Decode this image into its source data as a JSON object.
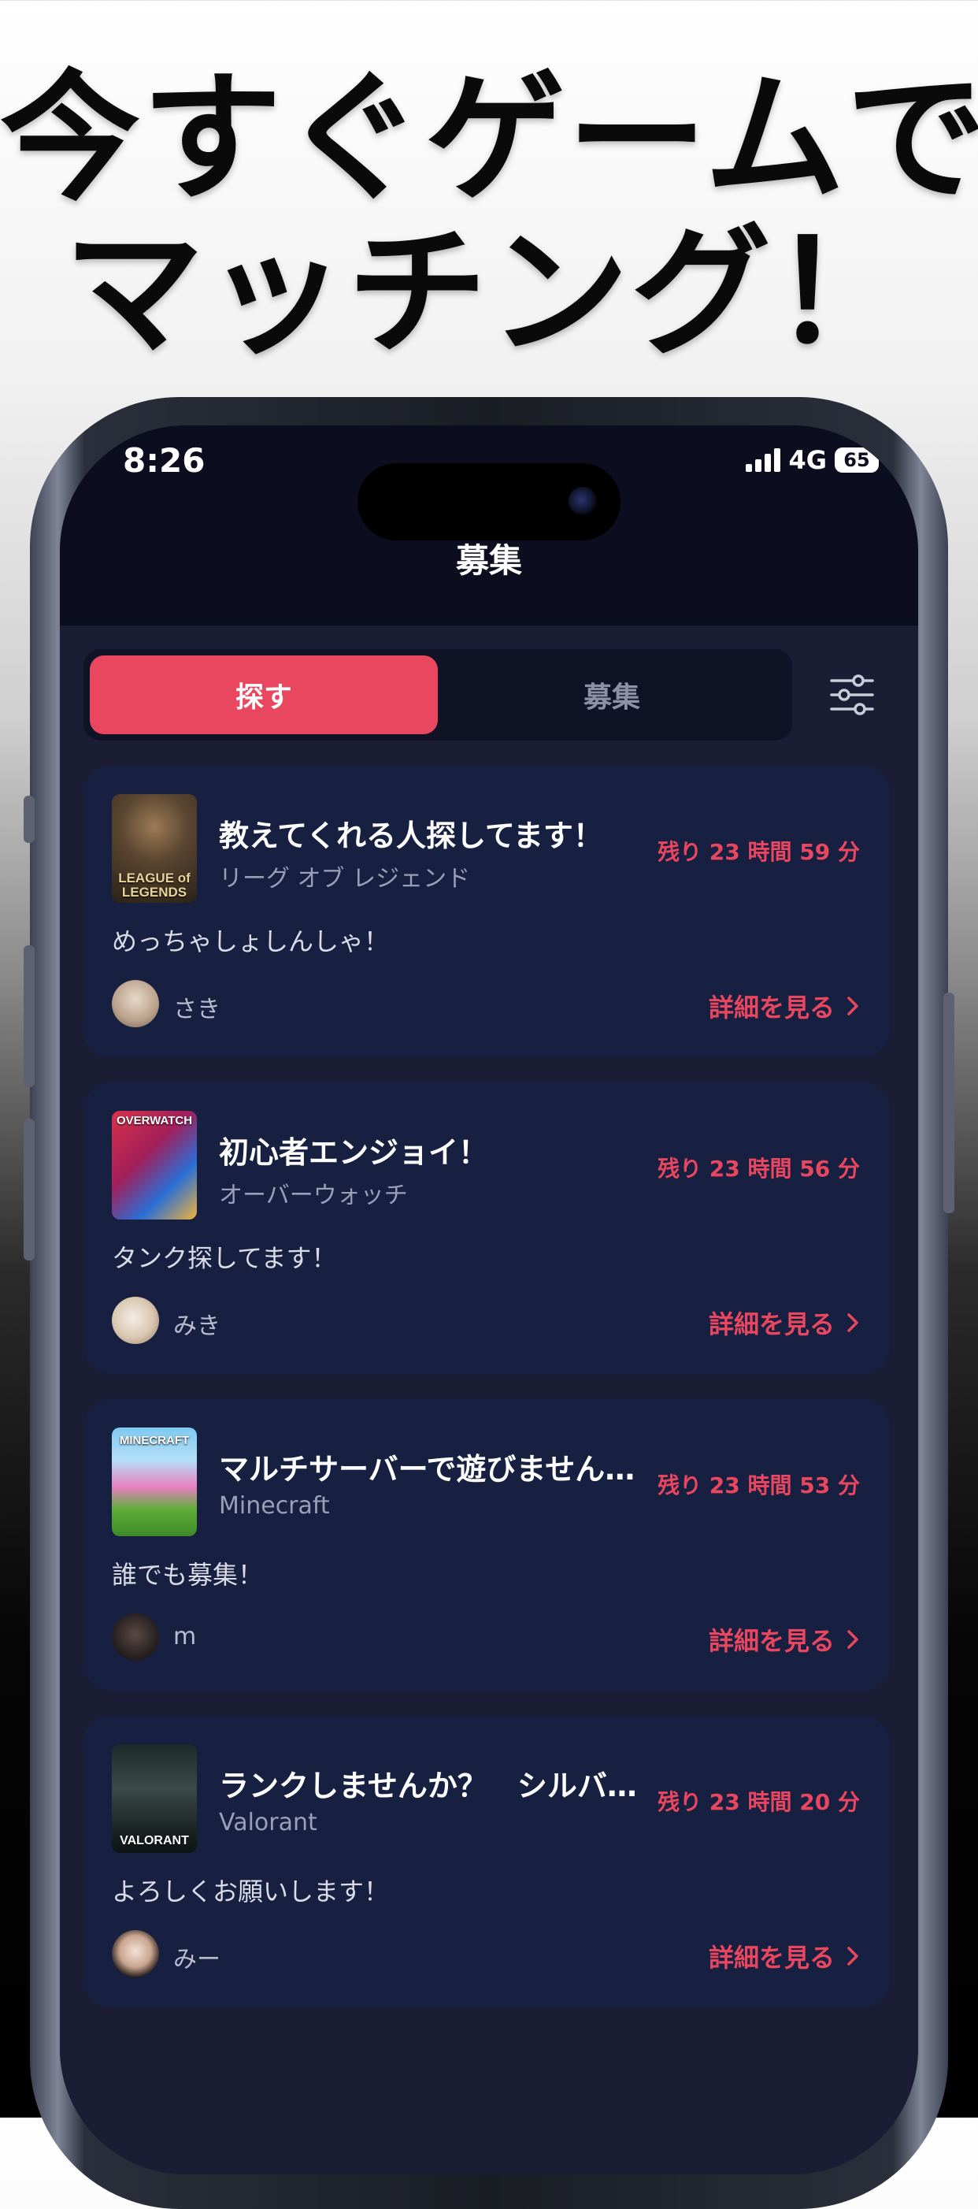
{
  "headline": {
    "line1": "今すぐゲームで",
    "line2": "マッチング！"
  },
  "status_bar": {
    "time": "8:26",
    "network": "4G",
    "battery": "65"
  },
  "nav": {
    "title": "募集"
  },
  "tabs": {
    "search_label": "探す",
    "recruit_label": "募集",
    "active": "探す"
  },
  "posts": [
    {
      "title": "教えてくれる人探してます！",
      "game": "リーグ オブ レジェンド",
      "thumb_label": "LEAGUE of LEGENDS",
      "remaining": "残り 23 時間 59 分",
      "description": "めっちゃしょしんしゃ！",
      "user": "さき",
      "link": "詳細を見る"
    },
    {
      "title": "初心者エンジョイ！",
      "game": "オーバーウォッチ",
      "thumb_label": "OVERWATCH",
      "remaining": "残り 23 時間 56 分",
      "description": "タンク探してます！",
      "user": "みき",
      "link": "詳細を見る"
    },
    {
      "title": "マルチサーバーで遊びません…",
      "game": "Minecraft",
      "thumb_label": "MINECRAFT",
      "remaining": "残り 23 時間 53 分",
      "description": "誰でも募集！",
      "user": "m",
      "link": "詳細を見る"
    },
    {
      "title": "ランクしませんか？　シルバ…",
      "game": "Valorant",
      "thumb_label": "VALORANT",
      "remaining": "残り 23 時間 20 分",
      "description": "よろしくお願いします！",
      "user": "みー",
      "link": "詳細を見る"
    }
  ],
  "colors": {
    "accent": "#e8475f",
    "card_bg": "#172040",
    "screen_bg": "#1a1d33"
  },
  "icons": {
    "filter": "sliders-icon",
    "chevron": "chevron-right-icon"
  }
}
